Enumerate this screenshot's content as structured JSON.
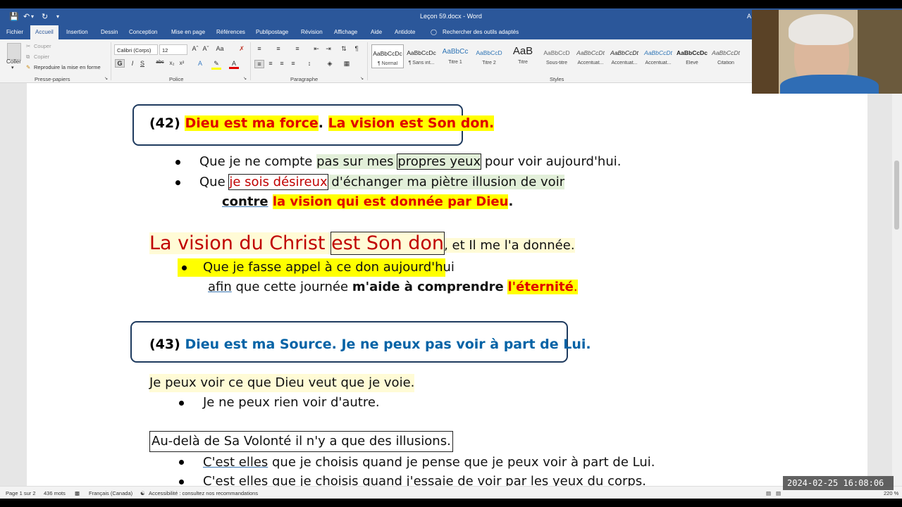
{
  "app": {
    "title": "Leçon 59.docx - Word",
    "user_initial": "A"
  },
  "quick_access": {
    "save_icon": "save-icon",
    "undo_icon": "undo-icon",
    "redo_icon": "redo-icon",
    "more_icon": "customize-icon"
  },
  "menu_tabs": [
    "Fichier",
    "Accueil",
    "Insertion",
    "Dessin",
    "Conception",
    "Mise en page",
    "Références",
    "Publipostage",
    "Révision",
    "Affichage",
    "Aide",
    "Antidote"
  ],
  "menu_active": "Accueil",
  "tell_me": "Rechercher des outils adaptés",
  "ribbon": {
    "clipboard": {
      "paste": "Coller",
      "cut": "Couper",
      "copy": "Copier",
      "format_painter": "Reproduire la mise en forme",
      "label": "Presse-papiers"
    },
    "font": {
      "name": "Calibri (Corps)",
      "size": "12",
      "label": "Police",
      "bold": "G",
      "italic": "I",
      "underline": "S",
      "strike": "abc"
    },
    "paragraph": {
      "label": "Paragraphe"
    },
    "styles": {
      "label": "Styles",
      "items": [
        {
          "sample": "AaBbCcDc",
          "name": "¶ Normal"
        },
        {
          "sample": "AaBbCcDc",
          "name": "¶ Sans int..."
        },
        {
          "sample": "AaBbCc",
          "name": "Titre 1"
        },
        {
          "sample": "AaBbCcD",
          "name": "Titre 2"
        },
        {
          "sample": "AaB",
          "name": "Titre"
        },
        {
          "sample": "AaBbCcD",
          "name": "Sous-titre"
        },
        {
          "sample": "AaBbCcDt",
          "name": "Accentuat..."
        },
        {
          "sample": "AaBbCcDt",
          "name": "Accentuat..."
        },
        {
          "sample": "AaBbCcDt",
          "name": "Accentuat..."
        },
        {
          "sample": "AaBbCcDc",
          "name": "Élevé"
        },
        {
          "sample": "AaBbCcDt",
          "name": "Citation"
        }
      ]
    }
  },
  "document": {
    "h42": {
      "num": "(42) ",
      "part1": "Dieu est ma force",
      "dot": ". ",
      "part2": "La vision est Son don."
    },
    "b1": {
      "a": "Que je ne compte ",
      "b": "pas sur mes ",
      "c": "propres yeux",
      "d": " pour voir aujourd'hui."
    },
    "b2": {
      "a": "Que ",
      "b": "je sois désireux",
      "c": " d'échanger ma piètre illusion de voir"
    },
    "b2cont": {
      "a": "contre",
      "b": " ",
      "c": "la vision qui est donnée par Dieu",
      "d": "."
    },
    "big": {
      "a": "La vision du Christ ",
      "b": "est Son don",
      "c": ", et Il me l'a donnée."
    },
    "b3": "Que je fasse appel à ce don aujourd'hui",
    "b3cont": {
      "a": "afin",
      "b": " que cette journée ",
      "c": "m'aide à comprendre",
      "d": " ",
      "e": "l'éternité",
      "f": "."
    },
    "h43": {
      "num": "(43) ",
      "text": "Dieu est ma Source. Je ne peux pas voir à part de Lui."
    },
    "p1": "Je peux voir ce que Dieu veut que je voie.",
    "b4": "Je ne peux rien voir d'autre.",
    "p2": "Au-delà de Sa Volonté il n'y a que des illusions.",
    "b5": {
      "a": "C'est elles",
      "b": " que je choisis quand je pense que je peux voir à part de Lui."
    },
    "b6": {
      "a": "C'est elles",
      "b": " que je choisis quand j'essaie de voir par les yeux du corps."
    }
  },
  "status": {
    "page": "Page 1 sur 2",
    "words": "436 mots",
    "language": "Français (Canada)",
    "accessibility": "Accessibilité : consultez nos recommandations",
    "zoom": "220 %"
  },
  "overlay_timestamp": "2024-02-25 16:08:06",
  "colors": {
    "titlebar": "#2b579a",
    "highlight_yellow": "#ffff00",
    "text_red": "#e00000",
    "heading_blue": "#0563a6"
  }
}
